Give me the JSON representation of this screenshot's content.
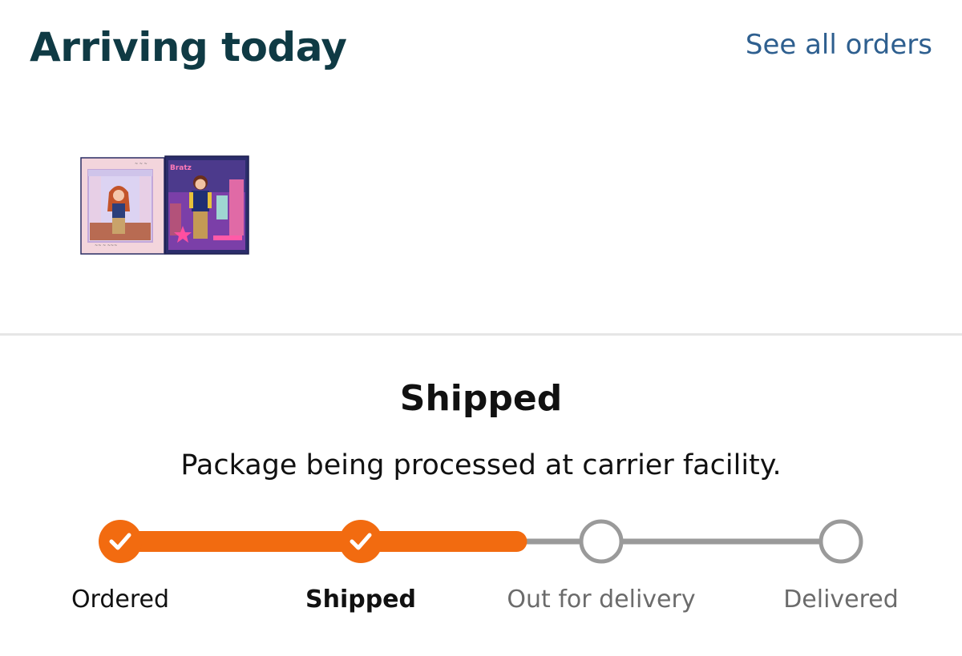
{
  "header": {
    "title": "Arriving today",
    "see_all_label": "See all orders"
  },
  "product": {
    "image_name": "doll-playset-product-image"
  },
  "status": {
    "title": "Shipped",
    "description": "Package being processed at carrier facility."
  },
  "tracker": {
    "accent_color": "#f26b10",
    "inactive_color": "#9a9a9a",
    "progress_fraction": 0.55,
    "steps": [
      {
        "label": "Ordered",
        "state": "complete"
      },
      {
        "label": "Shipped",
        "state": "complete",
        "current": true
      },
      {
        "label": "Out for delivery",
        "state": "pending"
      },
      {
        "label": "Delivered",
        "state": "pending"
      }
    ]
  }
}
